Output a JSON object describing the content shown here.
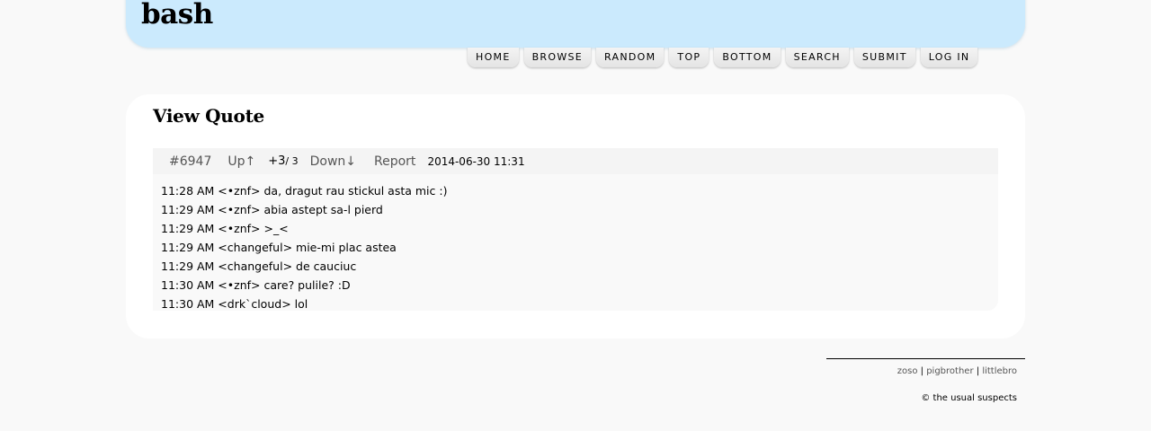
{
  "site": {
    "logo": "bash"
  },
  "nav": {
    "home": "HOME",
    "browse": "BROWSE",
    "random": "RANDOM",
    "top": "TOP",
    "bottom": "BOTTOM",
    "search": "SEARCH",
    "submit": "SUBMIT",
    "login": "LOG IN"
  },
  "page": {
    "title": "View Quote"
  },
  "quote": {
    "id": "#6947",
    "up_label": "Up↑",
    "score": "+3",
    "votes": "/ 3",
    "down_label": "Down↓",
    "report_label": "Report",
    "date": "2014-06-30 11:31",
    "lines": [
      "11:28 AM <•znf> da, dragut rau stickul asta mic :)",
      "11:29 AM <•znf> abia astept sa-l pierd",
      "11:29 AM <•znf> >_<",
      "11:29 AM <changeful> mie-mi plac astea",
      "11:29 AM <changeful> de cauciuc",
      "11:30 AM <•znf> care? pulile? :D",
      "11:30 AM <drk`cloud> lol"
    ]
  },
  "footer": {
    "link1": "zoso",
    "link2": "pigbrother",
    "link3": "littlebro",
    "separator": "|",
    "copyright": "© the usual suspects"
  }
}
